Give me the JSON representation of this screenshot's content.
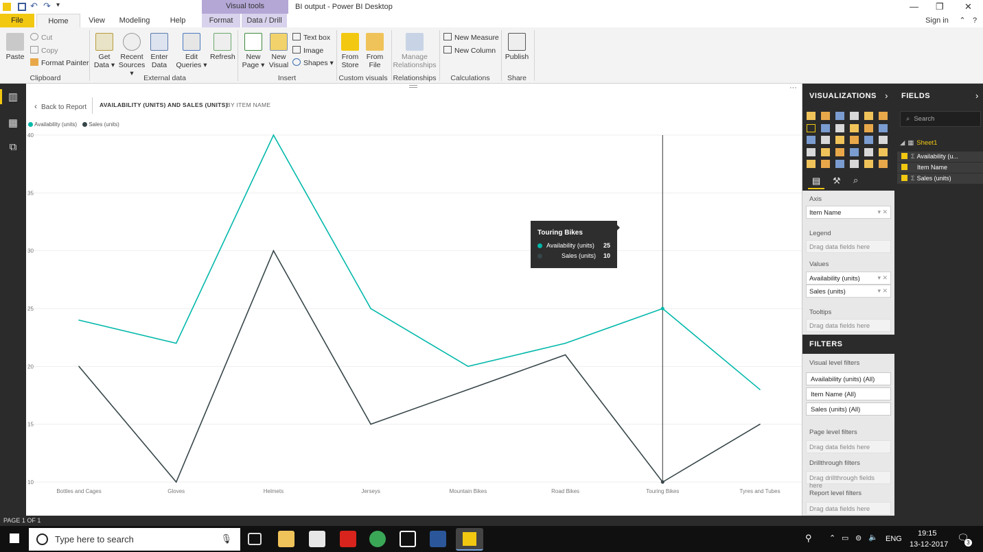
{
  "window": {
    "title": "BI output - Power BI Desktop",
    "context_tab_group": "Visual tools",
    "sign_in": "Sign in"
  },
  "tabs": [
    "File",
    "Home",
    "View",
    "Modeling",
    "Help",
    "Format",
    "Data / Drill"
  ],
  "ribbon": {
    "clipboard": {
      "paste": "Paste",
      "cut": "Cut",
      "copy": "Copy",
      "format_painter": "Format Painter",
      "label": "Clipboard"
    },
    "external": {
      "get_data_1": "Get",
      "get_data_2": "Data ▾",
      "recent_1": "Recent",
      "recent_2": "Sources ▾",
      "enter_1": "Enter",
      "enter_2": "Data",
      "edit_1": "Edit",
      "edit_2": "Queries ▾",
      "refresh": "Refresh",
      "label": "External data"
    },
    "insert": {
      "new_page_1": "New",
      "new_page_2": "Page ▾",
      "new_visual_1": "New",
      "new_visual_2": "Visual",
      "text_box": "Text box",
      "image": "Image",
      "shapes": "Shapes ▾",
      "label": "Insert"
    },
    "custom": {
      "from_store_1": "From",
      "from_store_2": "Store",
      "from_file_1": "From",
      "from_file_2": "File",
      "label": "Custom visuals"
    },
    "relationships": {
      "manage_1": "Manage",
      "manage_2": "Relationships",
      "label": "Relationships"
    },
    "calculations": {
      "new_measure": "New Measure",
      "new_column": "New Column",
      "label": "Calculations"
    },
    "share": {
      "publish": "Publish",
      "label": "Share"
    }
  },
  "report": {
    "back": "Back to Report",
    "title": "AVAILABILITY (UNITS) AND SALES (UNITS)",
    "by": "BY ITEM NAME",
    "page_status": "PAGE 1 OF 1"
  },
  "tooltip": {
    "title": "Touring Bikes",
    "rows": [
      {
        "label": "Availability (units)",
        "value": "25"
      },
      {
        "label": "Sales (units)",
        "value": "10"
      }
    ]
  },
  "chart_data": {
    "type": "line",
    "categories": [
      "Bottles and Cages",
      "Gloves",
      "Helmets",
      "Jerseys",
      "Mountain Bikes",
      "Road Bikes",
      "Touring Bikes",
      "Tyres and Tubes"
    ],
    "series": [
      {
        "name": "Availability (units)",
        "color": "#01b8aa",
        "values": [
          24,
          22,
          40,
          25,
          20,
          22,
          25,
          18
        ]
      },
      {
        "name": "Sales (units)",
        "color": "#374649",
        "values": [
          20,
          10,
          30,
          15,
          18,
          21,
          10,
          15
        ]
      }
    ],
    "ylim": [
      10,
      40
    ],
    "yticks": [
      "40",
      "35",
      "30",
      "25",
      "20",
      "15",
      "10"
    ],
    "highlighted_category": "Touring Bikes",
    "grid": true,
    "legend": "top-left"
  },
  "visualizations": {
    "title": "VISUALIZATIONS",
    "axis_label": "Axis",
    "axis_field": "Item Name",
    "legend_label": "Legend",
    "legend_placeholder": "Drag data fields here",
    "values_label": "Values",
    "values_fields": [
      "Availability (units)",
      "Sales (units)"
    ],
    "tooltips_label": "Tooltips",
    "tooltips_placeholder": "Drag data fields here"
  },
  "filters": {
    "title": "FILTERS",
    "visual_level": "Visual level filters",
    "visual_filters": [
      "Availability (units) (All)",
      "Item Name (All)",
      "Sales (units) (All)"
    ],
    "page_level": "Page level filters",
    "page_placeholder": "Drag data fields here",
    "drillthrough": "Drillthrough filters",
    "drillthrough_placeholder": "Drag drillthrough fields here",
    "report_level": "Report level filters",
    "report_placeholder": "Drag data fields here"
  },
  "fields": {
    "title": "FIELDS",
    "search_placeholder": "Search",
    "table": "Sheet1",
    "items": [
      "Availability (u...",
      "Item Name",
      "Sales (units)"
    ]
  },
  "taskbar": {
    "search_placeholder": "Type here to search",
    "language": "ENG",
    "time": "19:15",
    "date": "13-12-2017",
    "notification_count": "3"
  }
}
